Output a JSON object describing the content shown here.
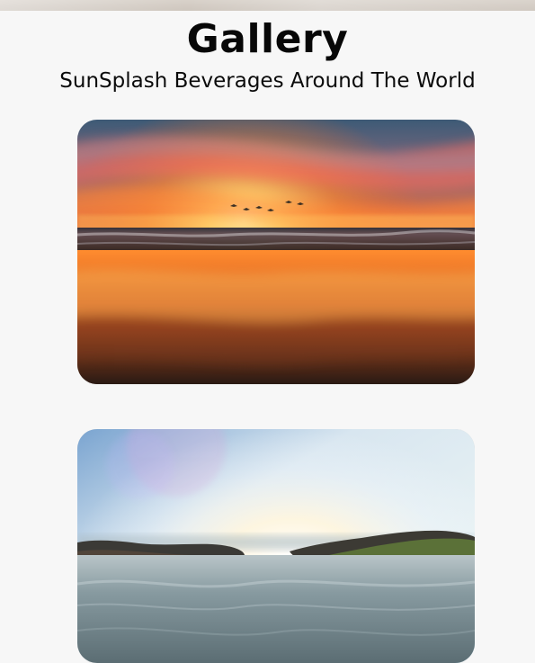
{
  "header": {
    "title": "Gallery",
    "subtitle": "SunSplash Beverages Around The World"
  },
  "gallery": {
    "images": [
      {
        "id": "img-sunset"
      },
      {
        "id": "img-rock-cove"
      }
    ]
  },
  "colors": {
    "page_bg": "#f7f7f7",
    "title": "#070707",
    "subtitle": "#0b0b0b"
  }
}
